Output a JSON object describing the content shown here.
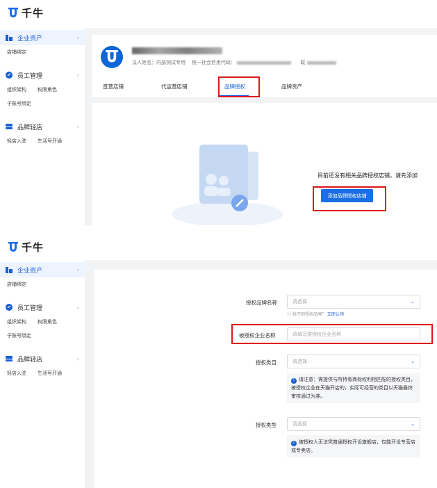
{
  "app": {
    "logo_text": "千牛"
  },
  "sidebar": {
    "groups": [
      {
        "title": "企业资产",
        "icon": "building-icon",
        "items": [
          "店铺绑定"
        ]
      },
      {
        "title": "员工管理",
        "icon": "user-manage-icon",
        "items": [
          "组织架构",
          "权限角色",
          "子账号绑定"
        ]
      },
      {
        "title": "品牌轻店",
        "icon": "store-icon",
        "items": [
          "轻店入驻",
          "生活号开通"
        ]
      }
    ]
  },
  "company": {
    "legal_label": "法人姓名：内部测试专用",
    "credit_label": "统一社会信用代码：",
    "contact_label": "联"
  },
  "tabs": [
    "直营店铺",
    "代运营店铺",
    "品牌授权",
    "品牌资产"
  ],
  "empty_state": {
    "message": "目前还没有相关品牌授权店铺，请先添加",
    "add_button": "添加品牌授权店铺"
  },
  "form": {
    "brand_label": "授权品牌名称",
    "brand_placeholder": "请选择",
    "brand_hint": "找不到授权品牌？",
    "brand_hint_link": "立即认领",
    "company_label": "被授权企业名称",
    "company_placeholder": "请填写被授权企业名称",
    "category_label": "授权类目",
    "category_placeholder": "请选择",
    "category_notice": "请注意：需提供与所持有商标权利相匹配的授权类目，被授权企业在天猫开店的，实际可经营的类目以天猫最终审核通过为准。",
    "type_label": "授权类型",
    "type_placeholder": "请选择",
    "type_notice": "被授权人无法凭普通授权开设旗舰店，仅能开设专营店或专卖店。"
  },
  "colors": {
    "primary": "#1a6fe6",
    "highlight": "#e0131a",
    "background": "#f2f3f5"
  }
}
